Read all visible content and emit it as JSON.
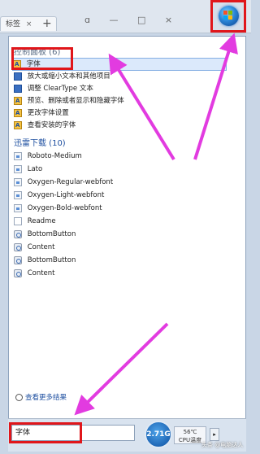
{
  "browser": {
    "tab_label": "标签",
    "tab_close": "×",
    "new_tab": "+",
    "window_controls": "ɑ — □ ×"
  },
  "control_panel": {
    "header": "控制面板 (6)",
    "items": [
      {
        "label": "字体"
      },
      {
        "label": "放大或缩小文本和其他项目"
      },
      {
        "label": "调整 ClearType 文本"
      },
      {
        "label": "预览、删除或者显示和隐藏字体"
      },
      {
        "label": "更改字体设置"
      },
      {
        "label": "查看安装的字体"
      }
    ]
  },
  "downloads": {
    "header": "迅雷下载 (10)",
    "items": [
      {
        "label": "Roboto-Medium"
      },
      {
        "label": "Lato"
      },
      {
        "label": "Oxygen-Regular-webfont"
      },
      {
        "label": "Oxygen-Light-webfont"
      },
      {
        "label": "Oxygen-Bold-webfont"
      },
      {
        "label": "Readme"
      },
      {
        "label": "BottomButton"
      },
      {
        "label": "Content"
      },
      {
        "label": "BottomButton"
      },
      {
        "label": "Content"
      }
    ]
  },
  "see_more": "查看更多结果",
  "search": {
    "value": "字体"
  },
  "speed": "2.71G",
  "temp": {
    "line1": "56℃",
    "line2": "CPU温度"
  },
  "shutdown_arrow": "▸",
  "watermark": "头条 @电脑达人",
  "colors": {
    "highlight": "#e0161b",
    "arrow": "#e23be0",
    "link": "#1e4fa0"
  }
}
